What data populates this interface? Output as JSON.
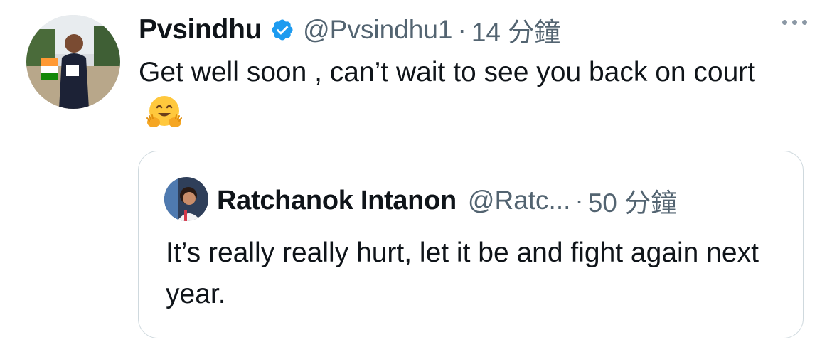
{
  "tweet": {
    "display_name": "Pvsindhu",
    "handle": "@Pvsindhu1",
    "separator": "·",
    "time": "14 分鐘",
    "text": "Get well soon , can’t wait to see you back on court",
    "avatar_icon": "profile-photo",
    "verified_icon": "verified-badge-icon",
    "emoji": "hugging-face-emoji"
  },
  "quote": {
    "display_name": "Ratchanok Intanon",
    "handle": "@Ratc...",
    "separator": "·",
    "time": "50 分鐘",
    "text": "It’s really really hurt, let it be and fight again next year."
  },
  "colors": {
    "text": "#0f1419",
    "secondary": "#536471",
    "verified": "#1d9bf0",
    "border": "#cfd9de"
  }
}
